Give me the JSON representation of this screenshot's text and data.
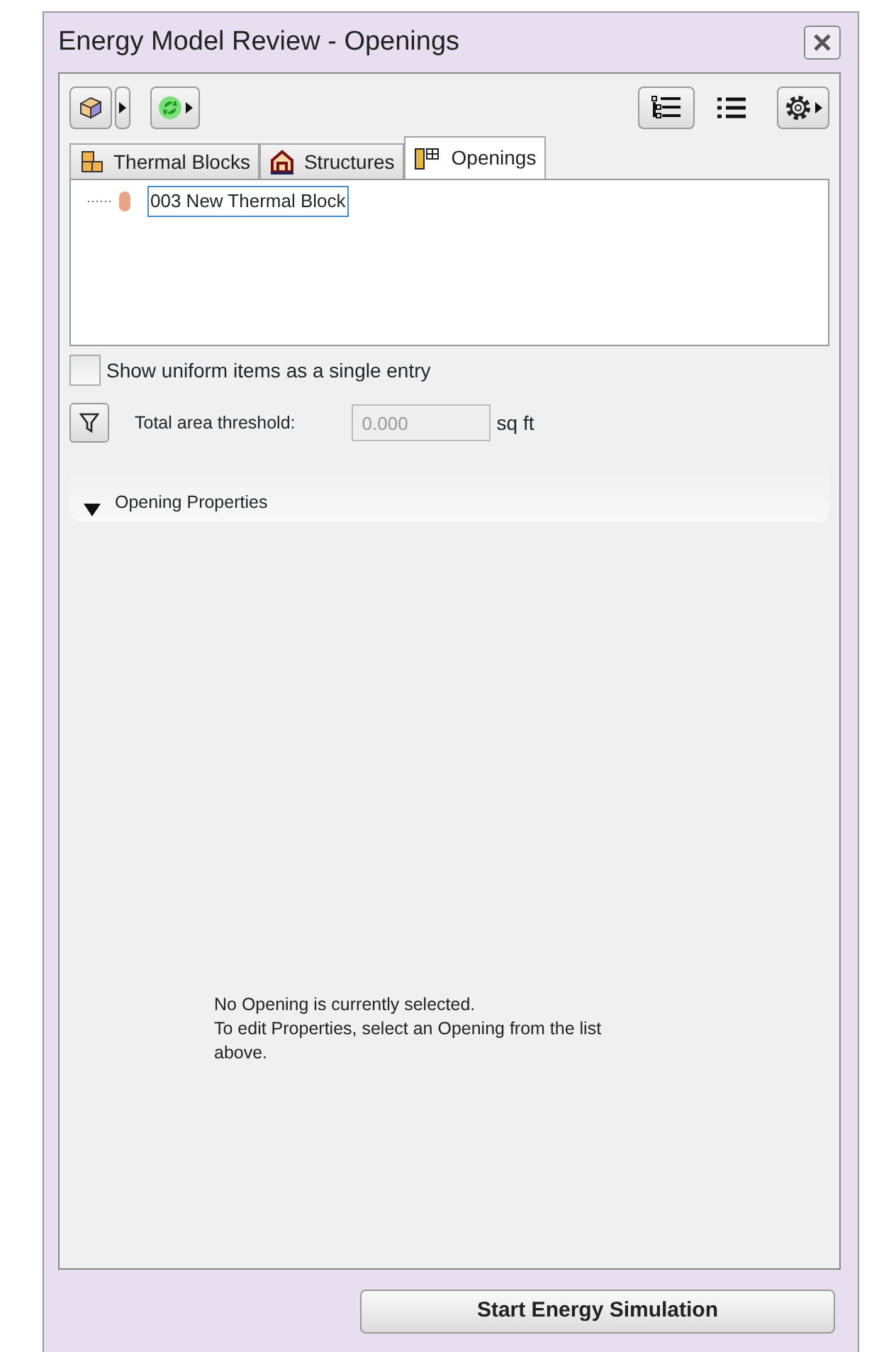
{
  "window": {
    "title": "Energy Model Review - Openings"
  },
  "toolbar": {
    "view_buttons": [
      {
        "kind": "tree",
        "selected": true
      },
      {
        "kind": "list",
        "selected": false
      }
    ]
  },
  "tabs": [
    {
      "label": "Thermal Blocks",
      "kind": "blocks",
      "selected": false
    },
    {
      "label": "Structures",
      "kind": "structures",
      "selected": false
    },
    {
      "label": "Openings",
      "kind": "openings",
      "selected": true
    }
  ],
  "tree": {
    "items": [
      {
        "label": "003 New Thermal Block",
        "selected": true
      }
    ]
  },
  "uniform_checkbox": {
    "label": "Show uniform items as a single entry",
    "checked": false
  },
  "threshold": {
    "label": "Total area threshold:",
    "value": "0.000",
    "unit": "sq ft",
    "disabled": true
  },
  "properties": {
    "title": "Opening Properties",
    "expanded": true,
    "message": [
      "No Opening is currently selected.",
      "To edit Properties, select an Opening from the list above."
    ]
  },
  "start_button": "Start Energy Simulation"
}
